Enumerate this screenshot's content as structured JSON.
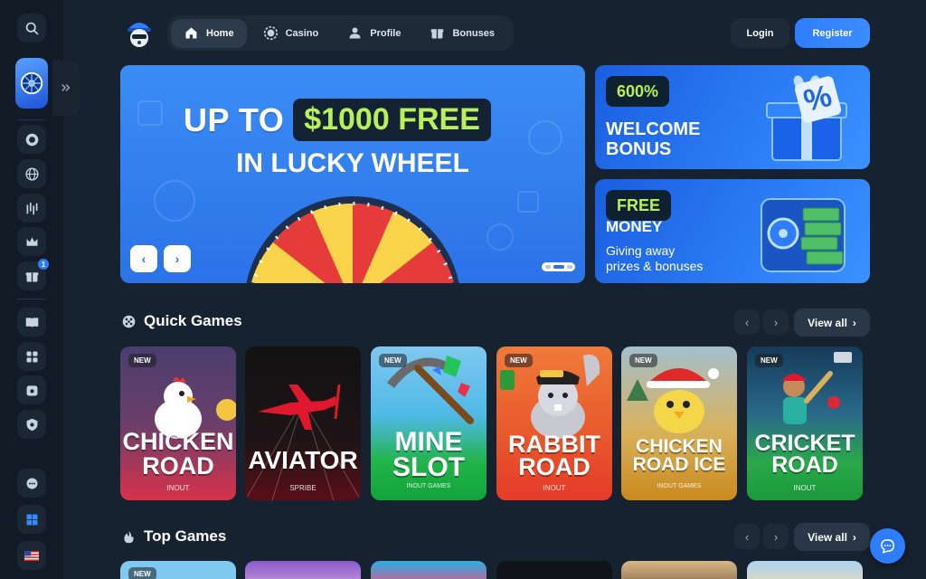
{
  "header": {
    "nav": [
      {
        "label": "Home",
        "icon": "home-icon",
        "active": true
      },
      {
        "label": "Casino",
        "icon": "casino-chip-icon",
        "active": false
      },
      {
        "label": "Profile",
        "icon": "user-icon",
        "active": false
      },
      {
        "label": "Bonuses",
        "icon": "gift-icon",
        "active": false
      }
    ],
    "login_label": "Login",
    "register_label": "Register"
  },
  "sidebar": {
    "badge_count": "1",
    "icons": [
      "search-icon",
      "lucky-wheel-icon",
      "casino-chip-icon",
      "globe-icon",
      "trading-icon",
      "crown-icon",
      "gift-icon",
      "book-icon",
      "dice-icon",
      "treasure-icon",
      "shield-icon",
      "support-chat-icon",
      "windows-icon",
      "us-flag-icon"
    ]
  },
  "hero": {
    "line1_prefix": "UP TO",
    "line1_highlight": "$1000 FREE",
    "line2": "IN LUCKY WHEEL",
    "prev_label": "‹",
    "next_label": "›"
  },
  "promos": [
    {
      "badge": "600%",
      "title_line1": "WELCOME",
      "title_line2": "BONUS"
    },
    {
      "badge": "FREE",
      "title_line1": "MONEY",
      "text_line1": "Giving away",
      "text_line2": "prizes & bonuses"
    }
  ],
  "quick_games": {
    "title": "Quick Games",
    "view_all": "View all",
    "games": [
      {
        "name_line1": "CHICKEN",
        "name_line2": "ROAD",
        "provider": "INOUT",
        "is_new": true,
        "new_label": "NEW"
      },
      {
        "name_line1": "AVIATOR",
        "name_line2": "",
        "provider": "SPRIBE",
        "is_new": false,
        "new_label": ""
      },
      {
        "name_line1": "MINE",
        "name_line2": "SLOT",
        "provider": "INOUT GAMES",
        "is_new": true,
        "new_label": "NEW"
      },
      {
        "name_line1": "RABBIT",
        "name_line2": "ROAD",
        "provider": "INOUT",
        "is_new": true,
        "new_label": "NEW"
      },
      {
        "name_line1": "CHICKEN",
        "name_line2": "ROAD ICE",
        "provider": "INOUT GAMES",
        "is_new": true,
        "new_label": "NEW"
      },
      {
        "name_line1": "CRICKET",
        "name_line2": "ROAD",
        "provider": "INOUT",
        "is_new": true,
        "new_label": "NEW"
      }
    ]
  },
  "top_games": {
    "title": "Top Games",
    "view_all": "View all",
    "first_new_label": "NEW"
  },
  "colors": {
    "background": "#172230",
    "sidebar": "#111a25",
    "accent_blue": "#2f7dff",
    "accent_green": "#b8f05a"
  }
}
